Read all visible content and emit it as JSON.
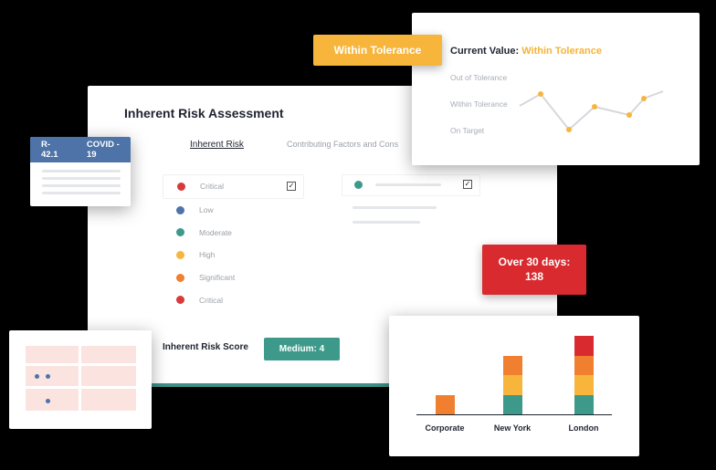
{
  "main_card": {
    "title": "Inherent Risk Assessment",
    "tabs": [
      "Inherent Risk",
      "Contributing Factors and Cons"
    ],
    "risk_levels": [
      {
        "label": "Critical",
        "color": "#d63a3a",
        "checked": true
      },
      {
        "label": "Low",
        "color": "#4d73a8"
      },
      {
        "label": "Moderate",
        "color": "#3d9a8b"
      },
      {
        "label": "High",
        "color": "#f7b53c"
      },
      {
        "label": "Significant",
        "color": "#f07f2f"
      },
      {
        "label": "Critical",
        "color": "#d63a3a"
      }
    ],
    "secondary_row": {
      "color": "#3d9a8b",
      "checked": true
    },
    "score_label": "Inherent Risk Score",
    "score_value": "Medium: 4",
    "score_color": "#3d9a8b"
  },
  "tolerance_badge": "Within Tolerance",
  "tolerance_card": {
    "current_value_label": "Current Value:",
    "current_value": "Within Tolerance",
    "y_labels": [
      "Out of Tolerance",
      "Within Tolerance",
      "On Target"
    ],
    "line_color": "#d5d8dc",
    "point_color": "#f7b53c"
  },
  "covid_card": {
    "id": "R-42.1",
    "name": "COVID - 19",
    "header_color": "#4d73a8"
  },
  "over_badge": {
    "line1": "Over 30 days:",
    "line2": "138",
    "color": "#d92b2f"
  },
  "chart_data": {
    "type": "bar",
    "stacked": true,
    "categories": [
      "Corporate",
      "New York",
      "London"
    ],
    "series": [
      {
        "color": "#3d9a8b",
        "values": [
          0,
          1,
          1
        ]
      },
      {
        "color": "#f7b53c",
        "values": [
          0,
          1,
          1
        ]
      },
      {
        "color": "#f07f2f",
        "values": [
          1,
          1,
          1
        ]
      },
      {
        "color": "#d92b2f",
        "values": [
          0,
          0,
          1
        ]
      }
    ],
    "xlabel": "",
    "ylabel": "",
    "grid": false
  }
}
